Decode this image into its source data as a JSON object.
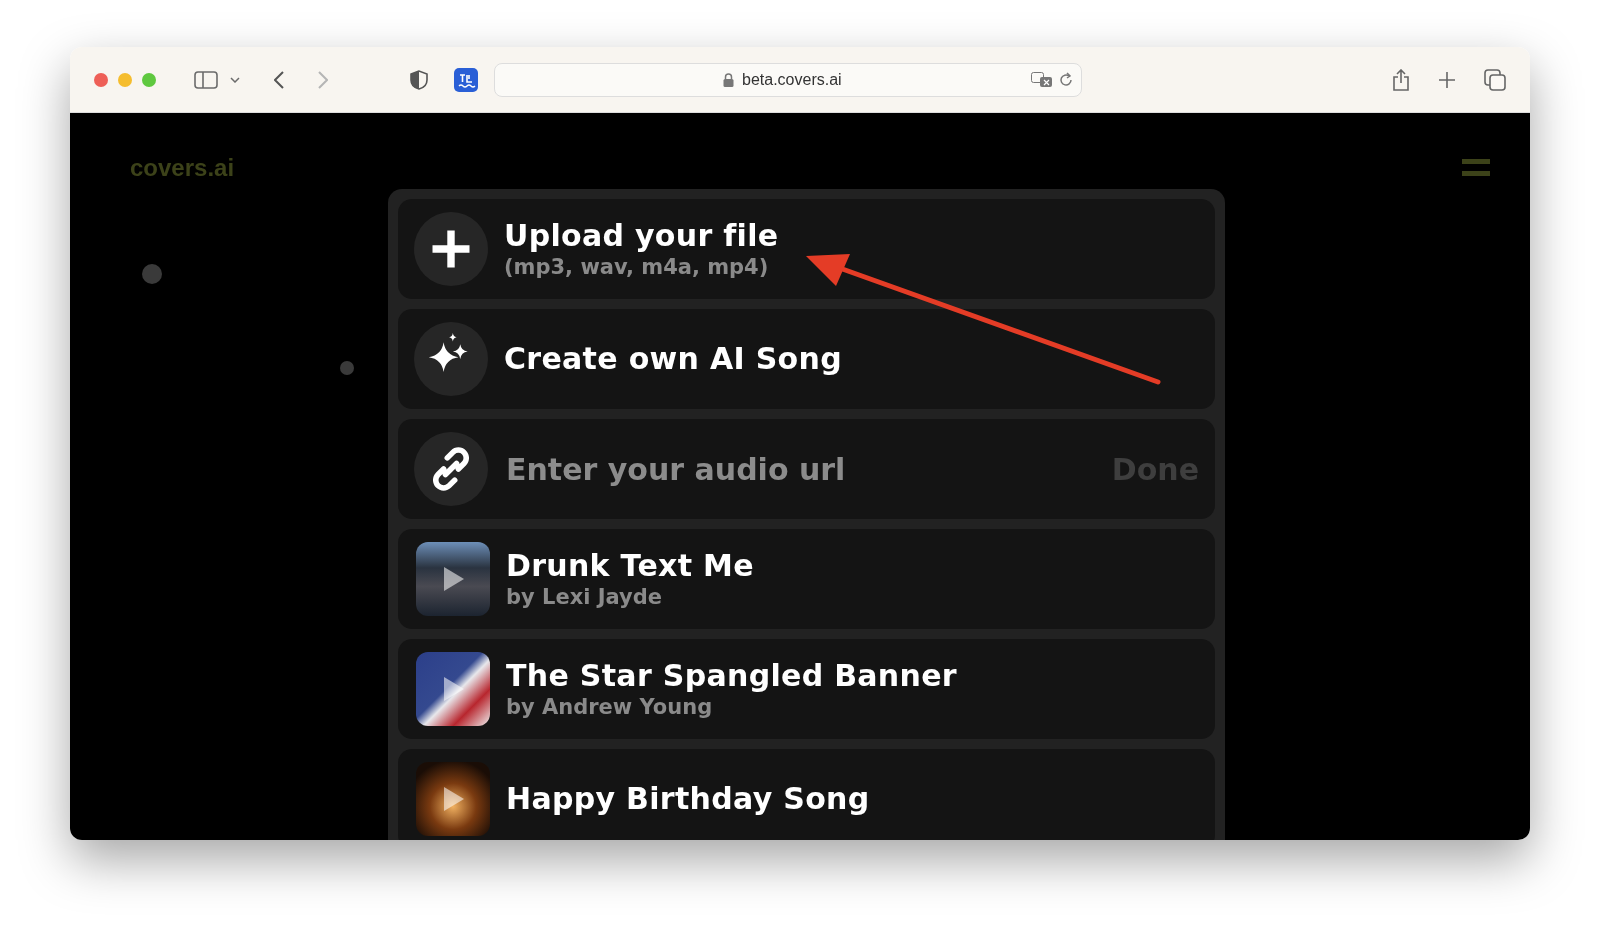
{
  "browser": {
    "url": "beta.covers.ai"
  },
  "site": {
    "logo": "covers.ai"
  },
  "options": [
    {
      "kind": "upload",
      "title": "Upload your file",
      "subtitle": "(mp3, wav, m4a, mp4)"
    },
    {
      "kind": "create",
      "title": "Create own AI Song"
    },
    {
      "kind": "url",
      "placeholder": "Enter your audio url",
      "action": "Done",
      "disabled": true
    }
  ],
  "songs": [
    {
      "title": "Drunk Text Me",
      "artist": "by Lexi Jayde"
    },
    {
      "title": "The Star Spangled Banner",
      "artist": "by Andrew Young"
    },
    {
      "title": "Happy Birthday Song"
    }
  ]
}
